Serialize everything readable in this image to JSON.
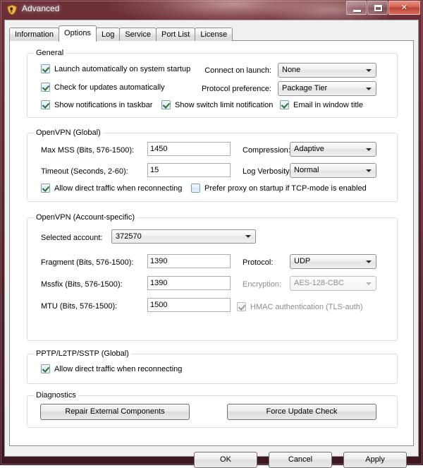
{
  "window": {
    "title": "Advanced",
    "icon": "shield-icon",
    "minimize_label": "",
    "maximize_label": "",
    "close_label": "✕"
  },
  "tabs": [
    {
      "label": "Information",
      "active": false
    },
    {
      "label": "Options",
      "active": true
    },
    {
      "label": "Log",
      "active": false
    },
    {
      "label": "Service",
      "active": false
    },
    {
      "label": "Port List",
      "active": false
    },
    {
      "label": "License",
      "active": false
    }
  ],
  "groups": {
    "general": {
      "title": "General",
      "checkboxes": [
        {
          "label": "Launch automatically on system startup",
          "checked": true,
          "enabled": true
        },
        {
          "label": "Check for updates automatically",
          "checked": true,
          "enabled": true
        },
        {
          "label": "Show notifications in taskbar",
          "checked": true,
          "enabled": true
        },
        {
          "label": "Show switch limit notification",
          "checked": true,
          "enabled": true
        },
        {
          "label": "Email in window title",
          "checked": true,
          "enabled": true
        }
      ],
      "connect_on_launch": {
        "label": "Connect on launch:",
        "value": "None"
      },
      "protocol_preference": {
        "label": "Protocol preference:",
        "value": "Package Tier"
      }
    },
    "openvpn_global": {
      "title": "OpenVPN (Global)",
      "max_mss": {
        "label": "Max MSS (Bits, 576-1500):",
        "value": "1450"
      },
      "timeout": {
        "label": "Timeout (Seconds, 2-60):",
        "value": "15"
      },
      "compression": {
        "label": "Compression:",
        "value": "Adaptive"
      },
      "log_verbosity": {
        "label": "Log Verbosity:",
        "value": "Normal"
      },
      "allow_direct": {
        "label": "Allow direct traffic when reconnecting",
        "checked": true
      },
      "prefer_proxy": {
        "label": "Prefer proxy on startup if TCP-mode is enabled",
        "checked": false
      }
    },
    "openvpn_account": {
      "title": "OpenVPN (Account-specific)",
      "selected_account": {
        "label": "Selected account:",
        "value": "372570"
      },
      "fragment": {
        "label": "Fragment (Bits, 576-1500):",
        "value": "1390"
      },
      "mssfix": {
        "label": "Mssfix (Bits, 576-1500):",
        "value": "1390"
      },
      "mtu": {
        "label": "MTU (Bits, 576-1500):",
        "value": "1500"
      },
      "protocol": {
        "label": "Protocol:",
        "value": "UDP",
        "enabled": true
      },
      "encryption": {
        "label": "Encryption:",
        "value": "AES-128-CBC",
        "enabled": false
      },
      "hmac": {
        "label": "HMAC authentication (TLS-auth)",
        "checked": true,
        "enabled": false
      }
    },
    "pptp": {
      "title": "PPTP/L2TP/SSTP (Global)",
      "allow_direct": {
        "label": "Allow direct traffic when reconnecting",
        "checked": true
      }
    },
    "diagnostics": {
      "title": "Diagnostics",
      "repair_button": "Repair External Components",
      "force_update_button": "Force Update Check"
    }
  },
  "footer": {
    "ok": "OK",
    "cancel": "Cancel",
    "apply": "Apply"
  },
  "colors": {
    "frame": "#5d2730",
    "client_bg": "#f0f0f0",
    "page_bg": "#ffffff",
    "group_border": "#d5dfe8",
    "close_button": "#bc3f30"
  }
}
